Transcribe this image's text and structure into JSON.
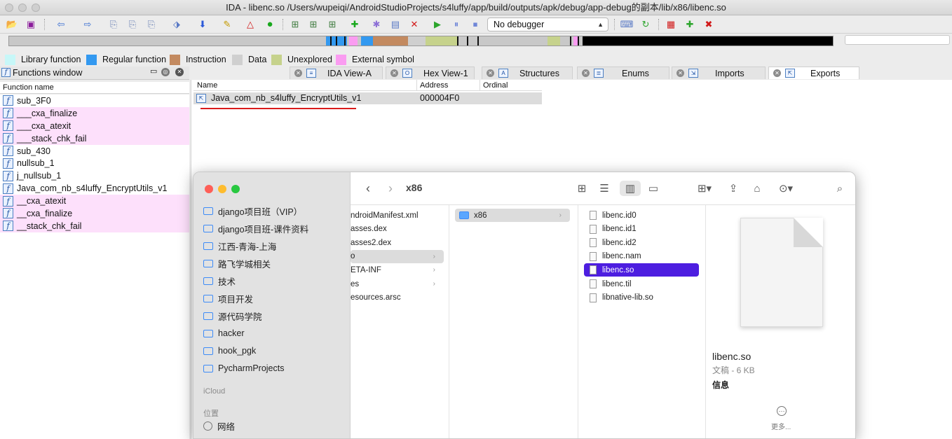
{
  "window": {
    "title": "IDA - libenc.so /Users/wupeiqi/AndroidStudioProjects/s4luffy/app/build/outputs/apk/debug/app-debug的副本/lib/x86/libenc.so"
  },
  "toolbar": {
    "debugger_value": "No debugger"
  },
  "legend": [
    {
      "label": "Library function",
      "color": "#c7f7f8"
    },
    {
      "label": "Regular function",
      "color": "#3399f0"
    },
    {
      "label": "Instruction",
      "color": "#c38a60"
    },
    {
      "label": "Data",
      "color": "#cfcfcf"
    },
    {
      "label": "Unexplored",
      "color": "#c6d28c"
    },
    {
      "label": "External symbol",
      "color": "#fa9cf1"
    }
  ],
  "functions_window": {
    "title": "Functions window",
    "column": "Function name",
    "items": [
      {
        "name": "sub_3F0",
        "external": false
      },
      {
        "name": "___cxa_finalize",
        "external": true
      },
      {
        "name": "___cxa_atexit",
        "external": true
      },
      {
        "name": "___stack_chk_fail",
        "external": true
      },
      {
        "name": "sub_430",
        "external": false
      },
      {
        "name": "nullsub_1",
        "external": false
      },
      {
        "name": "j_nullsub_1",
        "external": false
      },
      {
        "name": "Java_com_nb_s4luffy_EncryptUtils_v1",
        "external": false
      },
      {
        "name": "__cxa_atexit",
        "external": true
      },
      {
        "name": "__cxa_finalize",
        "external": true
      },
      {
        "name": "__stack_chk_fail",
        "external": true
      }
    ]
  },
  "tabs": [
    {
      "label": "IDA View-A",
      "active": false
    },
    {
      "label": "Hex View-1",
      "active": false
    },
    {
      "label": "Structures",
      "active": false
    },
    {
      "label": "Enums",
      "active": false
    },
    {
      "label": "Imports",
      "active": false
    },
    {
      "label": "Exports",
      "active": true
    }
  ],
  "exports": {
    "columns": [
      "Name",
      "Address",
      "Ordinal"
    ],
    "rows": [
      {
        "name": "Java_com_nb_s4luffy_EncryptUtils_v1",
        "address": "000004F0",
        "ordinal": ""
      }
    ]
  },
  "finder": {
    "current_folder": "x86",
    "sidebar_items": [
      "django项目班（VIP）",
      "django项目班-课件资料",
      "江西-青海-上海",
      "路飞学城相关",
      "技术",
      "项目开发",
      "源代码学院",
      "hacker",
      "hook_pgk",
      "PycharmProjects"
    ],
    "sidebar_section_icloud": "iCloud",
    "sidebar_section_locations": "位置",
    "sidebar_network": "网络",
    "column1": [
      "ndroidManifest.xml",
      "asses.dex",
      "asses2.dex",
      "o",
      "ETA-INF",
      "es",
      "esources.arsc"
    ],
    "column2": [
      "x86"
    ],
    "column3": [
      "libenc.id0",
      "libenc.id1",
      "libenc.id2",
      "libenc.nam",
      "libenc.so",
      "libenc.til",
      "libnative-lib.so"
    ],
    "preview": {
      "filename": "libenc.so",
      "kind": "文稿 - 6 KB",
      "info_heading": "信息",
      "more_label": "更多..."
    }
  }
}
